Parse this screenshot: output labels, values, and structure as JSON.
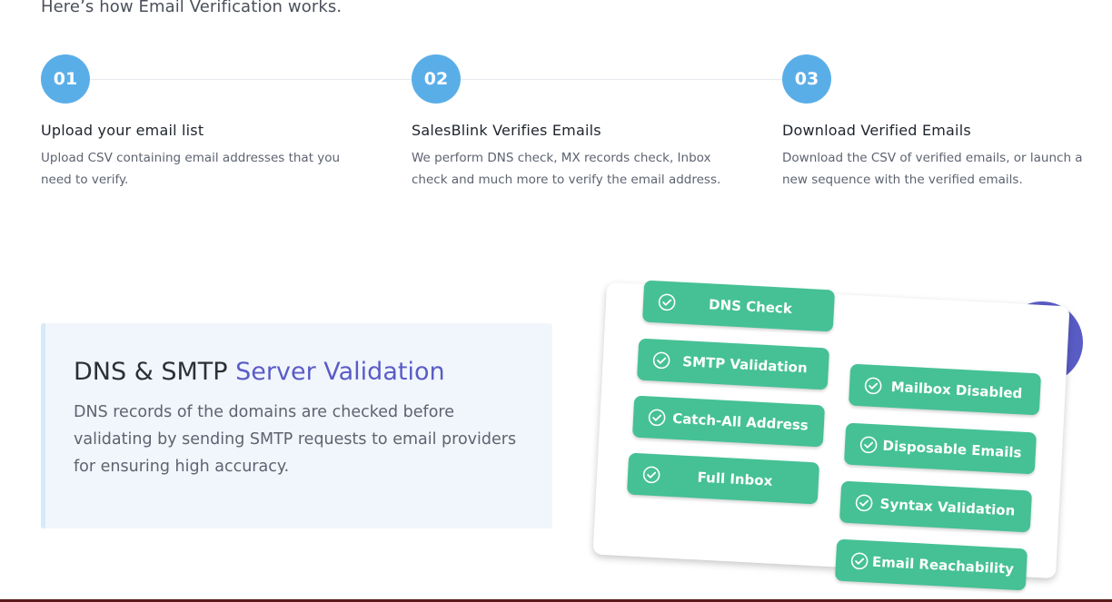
{
  "intro": "Here’s how Email Verification works.",
  "steps": [
    {
      "num": "01",
      "title": "Upload your email list",
      "desc": "Upload CSV containing email addresses that you need to verify."
    },
    {
      "num": "02",
      "title": "SalesBlink Verifies Emails",
      "desc": "We perform DNS check, MX records check, Inbox check and much more to verify the email address."
    },
    {
      "num": "03",
      "title": "Download Verified Emails",
      "desc": "Download the CSV of verified emails, or launch a new sequence with the verified emails."
    }
  ],
  "dns": {
    "title_plain": "DNS & SMTP ",
    "title_accent": "Server Validation",
    "desc": "DNS records of the domains are checked before validating by sending SMTP requests to email providers for ensuring high accuracy."
  },
  "checks": [
    {
      "label": "DNS Check",
      "icon": "check-circle-icon"
    },
    {
      "label": "SMTP Validation",
      "icon": "check-circle-icon"
    },
    {
      "label": "Catch-All Address",
      "icon": "check-circle-icon"
    },
    {
      "label": "Full Inbox",
      "icon": "check-circle-icon"
    },
    {
      "label": "Mailbox Disabled",
      "icon": "check-circle-icon"
    },
    {
      "label": "Disposable Emails",
      "icon": "check-circle-icon"
    },
    {
      "label": "Syntax Validation",
      "icon": "check-circle-icon"
    },
    {
      "label": "Email Reachability",
      "icon": "check-circle-icon"
    }
  ],
  "colors": {
    "step_circle": "#5aaee8",
    "accent_purple": "#5a5cc6",
    "pill_green": "#45c195",
    "card_bg": "#f1f6fc"
  }
}
